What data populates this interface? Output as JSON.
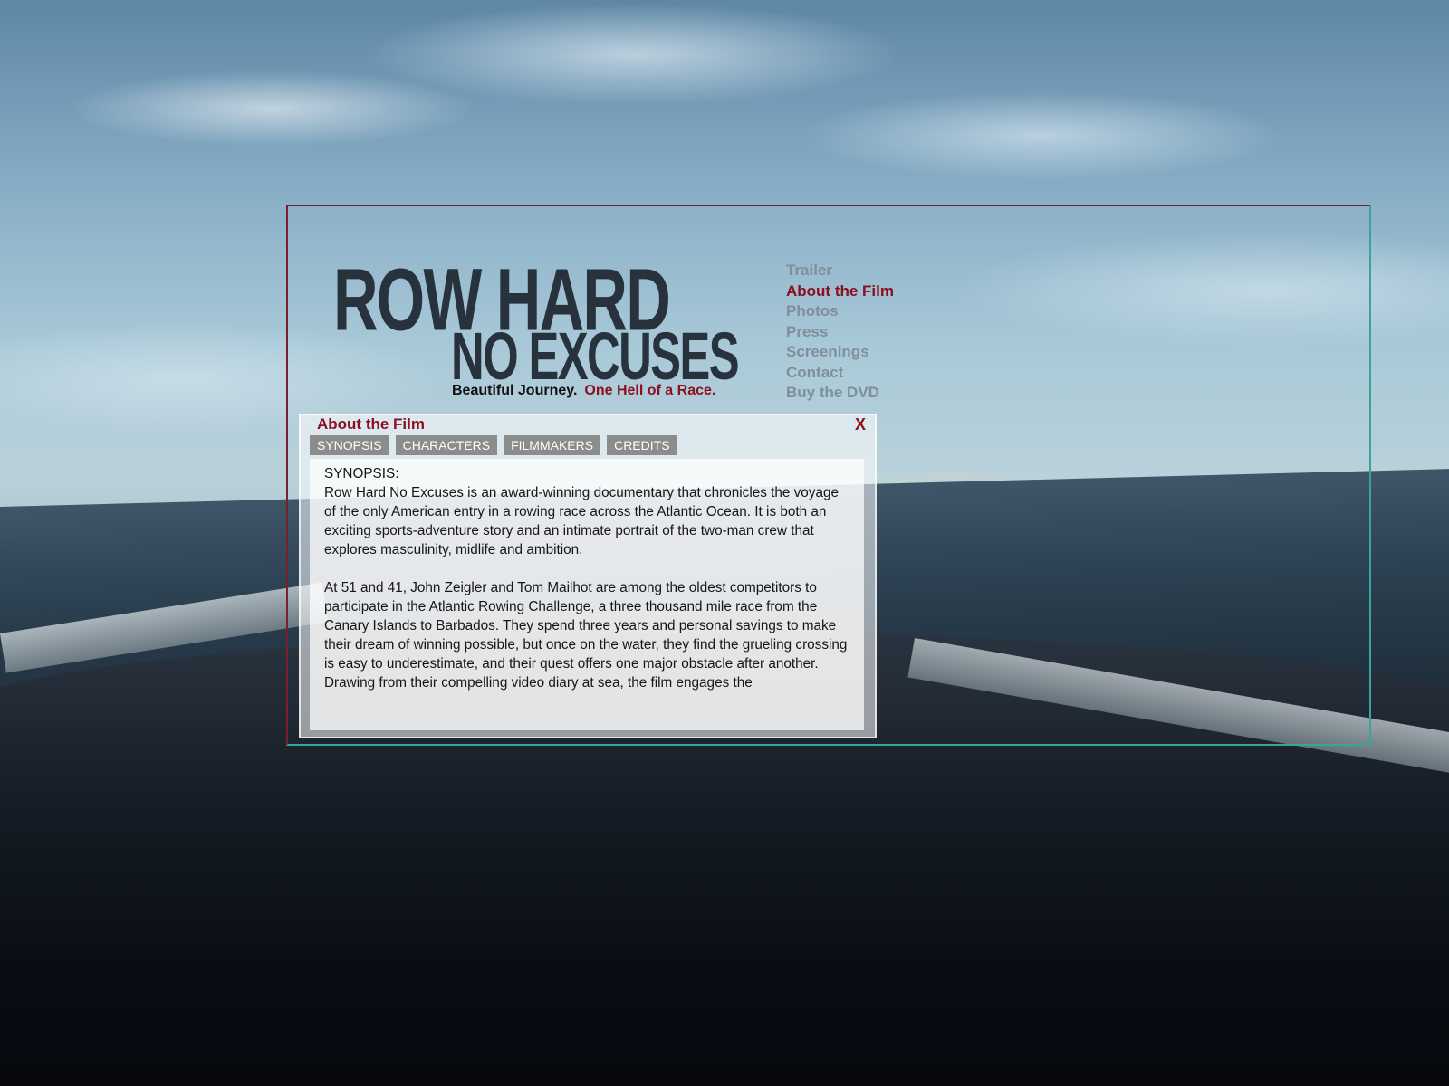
{
  "logo": {
    "line1": "ROW HARD",
    "line2": "NO EXCUSES",
    "tagline_part1": "Beautiful Journey.",
    "tagline_part2": "One Hell of a Race."
  },
  "nav": {
    "items": [
      {
        "label": "Trailer"
      },
      {
        "label": "About the Film",
        "active": true
      },
      {
        "label": "Photos"
      },
      {
        "label": "Press"
      },
      {
        "label": "Screenings"
      },
      {
        "label": "Contact"
      },
      {
        "label": "Buy the DVD"
      }
    ]
  },
  "panel": {
    "title": "About the Film",
    "close_label": "X",
    "tabs": [
      {
        "label": "SYNOPSIS"
      },
      {
        "label": "CHARACTERS"
      },
      {
        "label": "FILMMAKERS"
      },
      {
        "label": "CREDITS"
      }
    ],
    "section_heading": "SYNOPSIS:",
    "paragraph1": "Row Hard No Excuses is an award-winning documentary that chronicles the voyage of the only American entry in a rowing race across the Atlantic Ocean. It is both an exciting sports-adventure story and an intimate portrait of the two-man crew that explores masculinity, midlife and ambition.",
    "paragraph2": "At 51 and 41, John Zeigler and Tom Mailhot are among the oldest competitors to participate in the Atlantic Rowing Challenge, a three thousand mile race from the Canary Islands to Barbados. They spend three years and personal savings to make their dream of winning possible, but once on the water, they find the grueling crossing is easy to underestimate, and their quest offers one major obstacle after another. Drawing from their compelling video diary at sea, the film engages the"
  },
  "colors": {
    "accent": "#8e1020",
    "nav_inactive": "#7f8f9c",
    "tab_bg": "#8c8c8c",
    "frame_top_left": "#7b1f2e",
    "frame_bottom_right": "#3aa39b"
  }
}
